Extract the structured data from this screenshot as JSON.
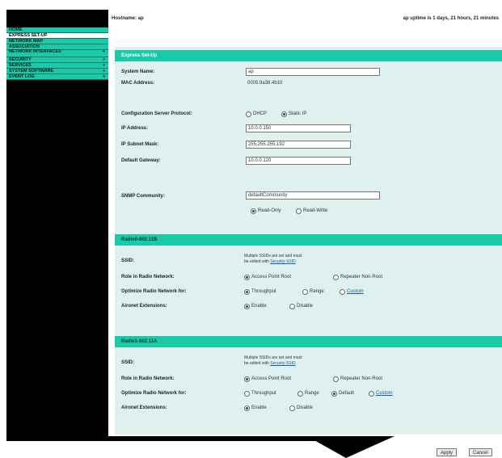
{
  "header": {
    "hostname": "Hostname: ap",
    "uptime": "ap uptime is 1 days, 21 hours, 21 minutes"
  },
  "sidebar": {
    "items": [
      {
        "label": "HOME"
      },
      {
        "label": "EXPRESS SET-UP"
      },
      {
        "label": "NETWORK MAP"
      },
      {
        "label": "ASSOCIATION"
      },
      {
        "label": "NETWORK INTERFACES"
      },
      {
        "label": "SECURITY"
      },
      {
        "label": "SERVICES"
      },
      {
        "label": "SYSTEM SOFTWARE"
      },
      {
        "label": "EVENT LOG"
      }
    ]
  },
  "express": {
    "section_title": "Express Set-Up",
    "system_name_label": "System Name:",
    "system_name_value": "ap",
    "mac_label": "MAC Address:",
    "mac_value": "0005.9a38.4b10",
    "config_protocol_label": "Configuration Server Protocol:",
    "dhcp_label": "DHCP",
    "static_ip_label": "Static IP",
    "ip_label": "IP Address:",
    "ip_value": "10.0.0.150",
    "subnet_label": "IP Subnet Mask:",
    "subnet_value": "255.255.255.192",
    "gateway_label": "Default Gateway:",
    "gateway_value": "10.0.0.120",
    "snmp_label": "SNMP Community:",
    "snmp_value": "defaultCommunity",
    "read_only_label": "Read-Only",
    "read_write_label": "Read-Write"
  },
  "radio0": {
    "title": "Radio0-802.11B",
    "ssid_label": "SSID:",
    "ssid_note": "Multiple SSIDs are set and must",
    "ssid_note2": "be edited with",
    "ssid_link": "Security-SSID",
    "role_label": "Role in Radio Network:",
    "ap_root_label": "Access Point Root",
    "repeater_label": "Repeater Non-Root",
    "optimize_label": "Optimize Radio Network for:",
    "throughput_label": "Throughput",
    "range_label": "Range",
    "custom_label": "Custom",
    "aironet_label": "Aironet Extensions:",
    "enable_label": "Enable",
    "disable_label": "Disable"
  },
  "radio1": {
    "title": "Radio1-802.11A",
    "ssid_label": "SSID:",
    "ssid_note": "Multiple SSIDs are set and must",
    "ssid_note2": "be edited with",
    "ssid_link": "Security-SSID",
    "role_label": "Role in Radio Network:",
    "ap_root_label": "Access Point Root",
    "repeater_label": "Repeater Non-Root",
    "optimize_label": "Optimize Radio Network for:",
    "throughput_label": "Throughput",
    "range_label": "Range",
    "default_label": "Default",
    "custom_label": "Custom",
    "aironet_label": "Aironet Extensions:",
    "enable_label": "Enable",
    "disable_label": "Disable"
  },
  "buttons": {
    "apply": "Apply",
    "cancel": "Cancel"
  },
  "colors": {
    "accent": "#19c9a8",
    "panel": "#dff1ef"
  }
}
